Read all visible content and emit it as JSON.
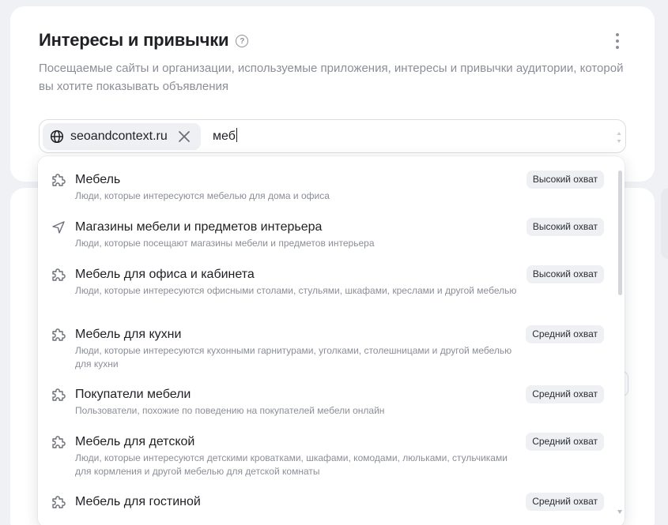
{
  "section": {
    "title": "Интересы и привычки",
    "description": "Посещаемые сайты и организации, используемые приложения, интересы и привычки аудитории, которой вы хотите показывать объявления"
  },
  "field": {
    "chip_label": "seoandcontext.ru",
    "chip_icon": "globe-icon",
    "query": "меб"
  },
  "suggestions": [
    {
      "icon": "puzzle-icon",
      "title": "Мебель",
      "subtitle": "Люди, которые интересуются мебелью для дома и офиса",
      "badge": "Высокий охват"
    },
    {
      "icon": "location-arrow-icon",
      "title": "Магазины мебели и предметов интерьера",
      "subtitle": "Люди, которые посещают магазины мебели и предметов интерьера",
      "badge": "Высокий охват"
    },
    {
      "icon": "puzzle-icon",
      "title": "Мебель для офиса и кабинета",
      "subtitle": "Люди, которые интересуются офисными столами, стульями, шкафами, креслами и другой мебелью",
      "badge": "Высокий охват"
    },
    {
      "icon": "puzzle-icon",
      "title": "Мебель для кухни",
      "subtitle": "Люди, которые интересуются кухонными гарнитурами, уголками, столешницами и другой мебелью для кухни",
      "badge": "Средний охват"
    },
    {
      "icon": "puzzle-icon",
      "title": "Покупатели мебели",
      "subtitle": "Пользователи, похожие по поведению на покупателей мебели онлайн",
      "badge": "Средний охват"
    },
    {
      "icon": "puzzle-icon",
      "title": "Мебель для детской",
      "subtitle": "Люди, которые интересуются детскими кроватками, шкафами, комодами, люльками, стульчиками для кормления и другой мебелью для детской комнаты",
      "badge": "Средний охват"
    },
    {
      "icon": "puzzle-icon",
      "title": "Мебель для гостиной",
      "subtitle": "",
      "badge": "Средний охват"
    }
  ]
}
